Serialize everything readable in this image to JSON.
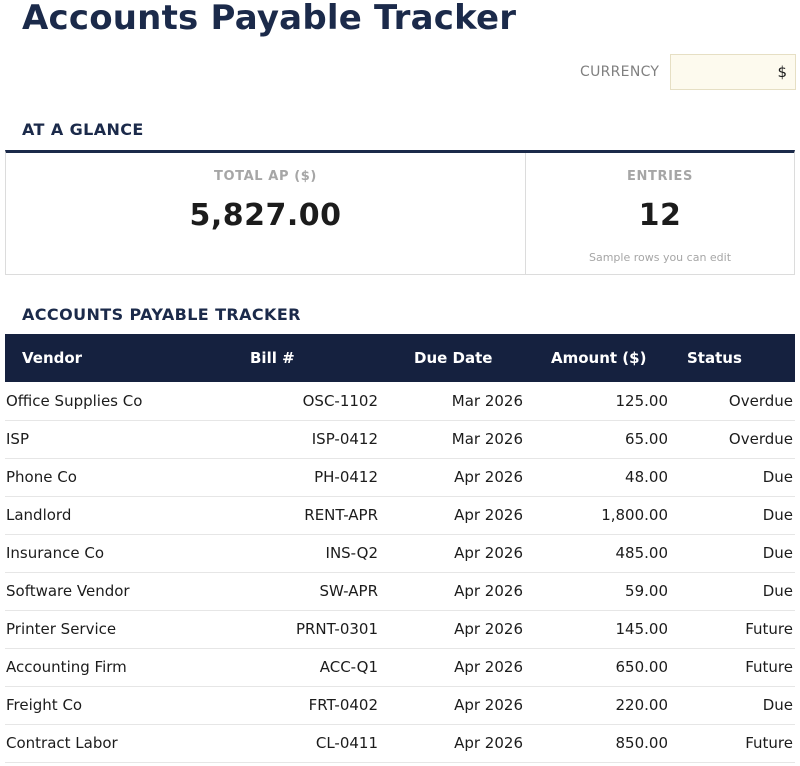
{
  "page": {
    "title": "Accounts Payable Tracker",
    "currency_label": "CURRENCY",
    "currency_value": "$"
  },
  "glance": {
    "heading": "AT A GLANCE",
    "total_label": "TOTAL AP ($)",
    "total_value": "5,827.00",
    "entries_label": "ENTRIES",
    "entries_value": "12",
    "entries_note": "Sample rows you can edit"
  },
  "tracker": {
    "heading": "ACCOUNTS PAYABLE TRACKER",
    "columns": [
      "Vendor",
      "Bill #",
      "Due Date",
      "Amount ($)",
      "Status"
    ],
    "rows": [
      {
        "vendor": "Office Supplies Co",
        "bill": "OSC-1102",
        "due": "Mar 2026",
        "amount": "125.00",
        "status": "Overdue"
      },
      {
        "vendor": "ISP",
        "bill": "ISP-0412",
        "due": "Mar 2026",
        "amount": "65.00",
        "status": "Overdue"
      },
      {
        "vendor": "Phone Co",
        "bill": "PH-0412",
        "due": "Apr 2026",
        "amount": "48.00",
        "status": "Due"
      },
      {
        "vendor": "Landlord",
        "bill": "RENT-APR",
        "due": "Apr 2026",
        "amount": "1,800.00",
        "status": "Due"
      },
      {
        "vendor": "Insurance Co",
        "bill": "INS-Q2",
        "due": "Apr 2026",
        "amount": "485.00",
        "status": "Due"
      },
      {
        "vendor": "Software Vendor",
        "bill": "SW-APR",
        "due": "Apr 2026",
        "amount": "59.00",
        "status": "Due"
      },
      {
        "vendor": "Printer Service",
        "bill": "PRNT-0301",
        "due": "Apr 2026",
        "amount": "145.00",
        "status": "Future"
      },
      {
        "vendor": "Accounting Firm",
        "bill": "ACC-Q1",
        "due": "Apr 2026",
        "amount": "650.00",
        "status": "Future"
      },
      {
        "vendor": "Freight Co",
        "bill": "FRT-0402",
        "due": "Apr 2026",
        "amount": "220.00",
        "status": "Due"
      },
      {
        "vendor": "Contract Labor",
        "bill": "CL-0411",
        "due": "Apr 2026",
        "amount": "850.00",
        "status": "Future"
      }
    ]
  },
  "colors": {
    "navy": "#1b2a4a",
    "header_bg": "#15213f",
    "input_bg": "#fdfaee"
  }
}
